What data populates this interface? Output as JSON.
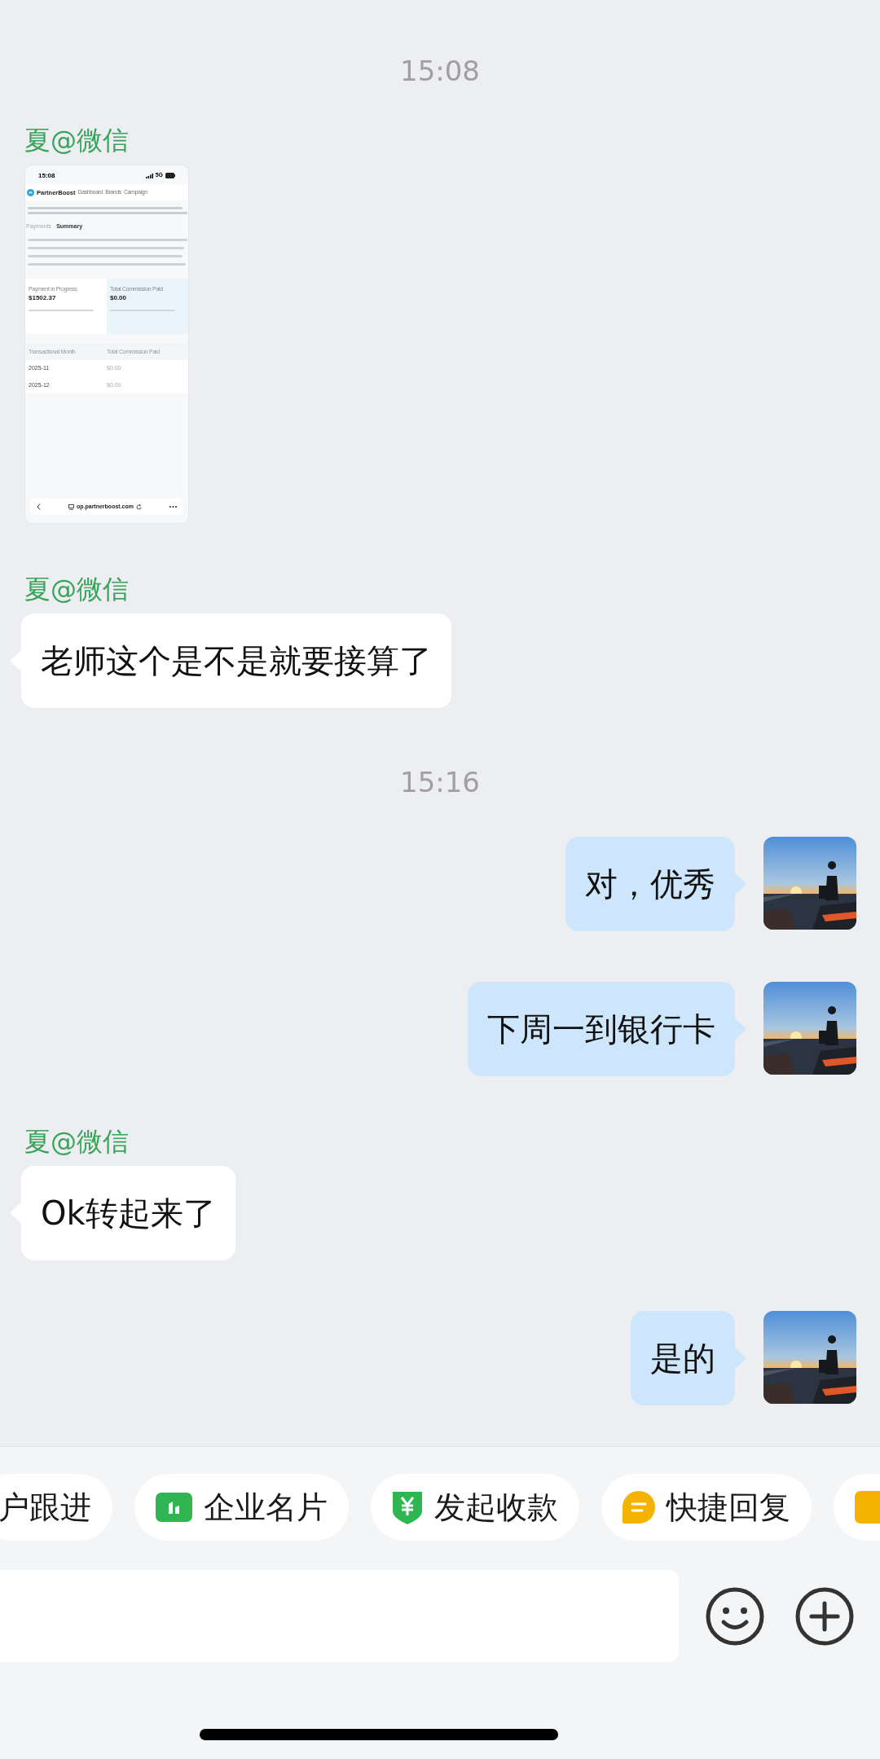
{
  "messages": [
    {
      "kind": "time",
      "text": "15:08"
    },
    {
      "kind": "image_in",
      "sender": "夏@微信",
      "screenshot": {
        "status_time": "15:08",
        "network": "5G",
        "brand": "PartnerBoost",
        "nav": [
          "Dashboard",
          "Brands",
          "Campaign"
        ],
        "breadcrumb": [
          "Payments",
          "Summary"
        ],
        "cards": [
          {
            "label": "Payment in Progress",
            "amount": "$1502.37",
            "highlight": false
          },
          {
            "label": "Total Commission Paid",
            "amount": "$0.00",
            "highlight": true
          }
        ],
        "table": {
          "columns": [
            "Transactional Month",
            "Total Commission Paid"
          ],
          "rows": [
            [
              "2025-11",
              "$0.00"
            ],
            [
              "2025-12",
              "$0.00"
            ]
          ]
        },
        "url": "op.partnerboost.com"
      }
    },
    {
      "kind": "text_in",
      "sender": "夏@微信",
      "text": "老师这个是不是就要接算了"
    },
    {
      "kind": "time",
      "text": "15:16"
    },
    {
      "kind": "text_out",
      "text": "对，优秀"
    },
    {
      "kind": "text_out",
      "text": "下周一到银行卡"
    },
    {
      "kind": "text_in",
      "sender": "夏@微信",
      "text": "Ok转起来了"
    },
    {
      "kind": "text_out",
      "text": "是的"
    }
  ],
  "quick_actions": [
    {
      "kind": "plain",
      "label": "户跟进"
    },
    {
      "kind": "card",
      "label": "企业名片"
    },
    {
      "kind": "yuan",
      "label": "发起收款"
    },
    {
      "kind": "chat",
      "label": "快捷回复"
    },
    {
      "kind": "note"
    }
  ]
}
